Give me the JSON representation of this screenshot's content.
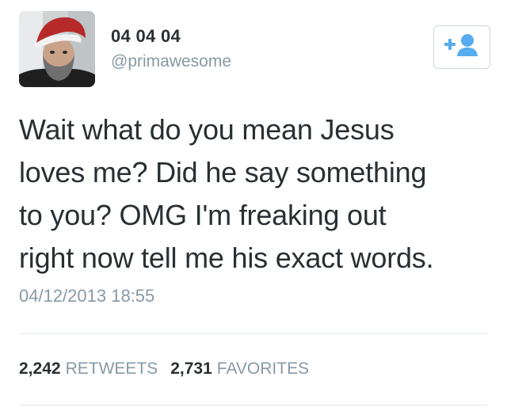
{
  "tweet": {
    "display_name": "04 04 04",
    "handle": "@primawesome",
    "text": "Wait what do you mean Jesus\nloves me? Did he say something\nto you? OMG I'm freaking out\nright now tell me his exact words.",
    "timestamp": "04/12/2013 18:55"
  },
  "stats": {
    "retweets_count": "2,242",
    "retweets_label": "RETWEETS",
    "favorites_count": "2,731",
    "favorites_label": "FAVORITES"
  },
  "icons": {
    "avatar": "profile-photo",
    "follow": "add-user-icon"
  },
  "colors": {
    "accent": "#55acee",
    "text_primary": "#292f33",
    "text_secondary": "#8899a6",
    "divider": "#e1e8ed"
  }
}
